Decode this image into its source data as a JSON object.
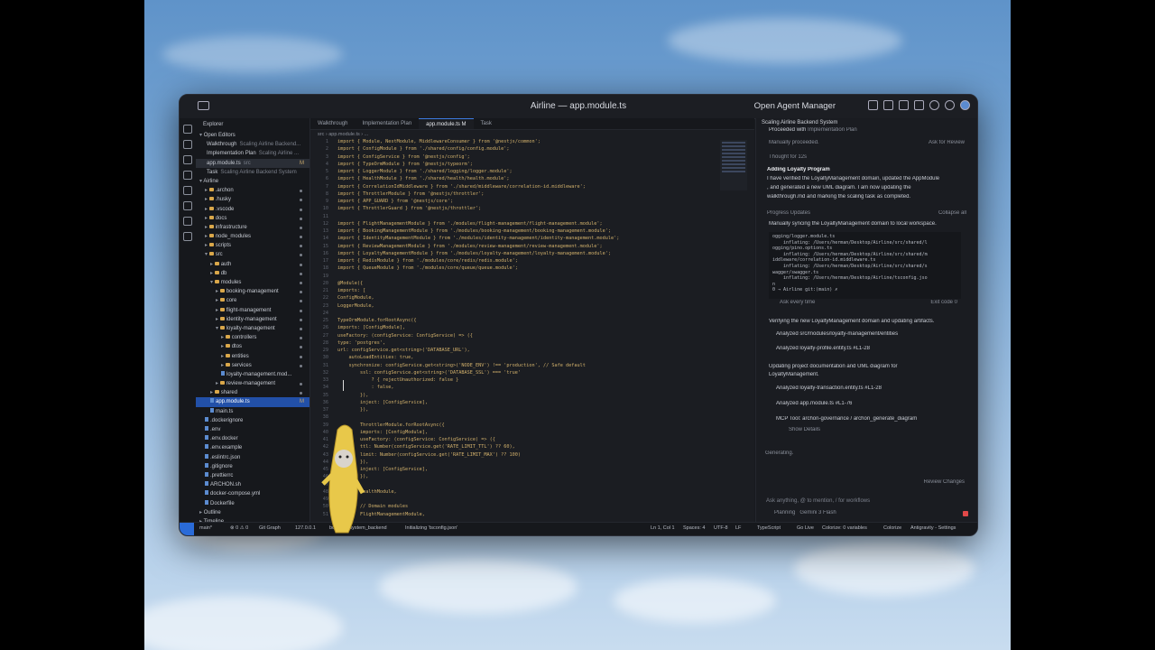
{
  "window": {
    "title": "Airline — app.module.ts",
    "right_title": "Open Agent Manager"
  },
  "explorer": {
    "header": "Explorer",
    "open_editors_label": "Open Editors",
    "open_editors": [
      {
        "name": "Walkthrough",
        "detail": "Scaling Airline Backend..."
      },
      {
        "name": "Implementation Plan",
        "detail": "Scaling Airline ..."
      },
      {
        "name": "app.module.ts",
        "detail": "src",
        "mark": "M"
      },
      {
        "name": "Task",
        "detail": "Scaling Airline Backend System"
      }
    ],
    "project_label": "Airline",
    "tree": [
      {
        "name": ".archon",
        "kind": "folder"
      },
      {
        "name": ".husky",
        "kind": "folder"
      },
      {
        "name": ".vscode",
        "kind": "folder"
      },
      {
        "name": "docs",
        "kind": "folder"
      },
      {
        "name": "infrastructure",
        "kind": "folder"
      },
      {
        "name": "node_modules",
        "kind": "folder"
      },
      {
        "name": "scripts",
        "kind": "folder"
      },
      {
        "name": "src",
        "kind": "folder-open"
      },
      {
        "name": "auth",
        "kind": "folder"
      },
      {
        "name": "db",
        "kind": "folder"
      },
      {
        "name": "modules",
        "kind": "folder-open"
      },
      {
        "name": "booking-management",
        "kind": "folder"
      },
      {
        "name": "core",
        "kind": "folder"
      },
      {
        "name": "flight-management",
        "kind": "folder"
      },
      {
        "name": "identity-management",
        "kind": "folder"
      },
      {
        "name": "loyalty-management",
        "kind": "folder-open"
      },
      {
        "name": "controllers",
        "kind": "folder"
      },
      {
        "name": "dtos",
        "kind": "folder"
      },
      {
        "name": "entities",
        "kind": "folder"
      },
      {
        "name": "services",
        "kind": "folder"
      },
      {
        "name": "loyalty-management.mod...",
        "kind": "file"
      },
      {
        "name": "review-management",
        "kind": "folder"
      },
      {
        "name": "shared",
        "kind": "folder"
      },
      {
        "name": "app.module.ts",
        "kind": "file",
        "selected": true,
        "mark": "M"
      },
      {
        "name": "main.ts",
        "kind": "file"
      },
      {
        "name": ".dockerignore",
        "kind": "file"
      },
      {
        "name": ".env",
        "kind": "file"
      },
      {
        "name": ".env.docker",
        "kind": "file"
      },
      {
        "name": ".env.example",
        "kind": "file"
      },
      {
        "name": ".eslintrc.json",
        "kind": "file"
      },
      {
        "name": ".gitignore",
        "kind": "file"
      },
      {
        "name": ".prettierrc",
        "kind": "file"
      },
      {
        "name": "ARCHON.sh",
        "kind": "file"
      },
      {
        "name": "docker-compose.yml",
        "kind": "file"
      },
      {
        "name": "Dockerfile",
        "kind": "file"
      }
    ],
    "outline_label": "Outline",
    "timeline_label": "Timeline"
  },
  "editor": {
    "tabs": [
      "Walkthrough",
      "Implementation Plan",
      "app.module.ts M",
      "Task"
    ],
    "breadcrumb": "src  ›  app.module.ts  ›  ...",
    "lines": [
      "import { Module, NestModule, MiddlewareConsumer } from '@nestjs/common';",
      "import { ConfigModule } from './shared/config/config.module';",
      "import { ConfigService } from '@nestjs/config';",
      "import { TypeOrmModule } from '@nestjs/typeorm';",
      "import { LoggerModule } from './shared/logging/logger.module';",
      "import { HealthModule } from './shared/health/health.module';",
      "import { CorrelationIdMiddleware } from './shared/middleware/correlation-id.middleware';",
      "import { ThrottlerModule } from '@nestjs/throttler';",
      "import { APP_GUARD } from '@nestjs/core';",
      "import { ThrottlerGuard } from '@nestjs/throttler';",
      "",
      "import { FlightManagementModule } from './modules/flight-management/flight-management.module';",
      "import { BookingManagementModule } from './modules/booking-management/booking-management.module';",
      "import { IdentityManagementModule } from './modules/identity-management/identity-management.module';",
      "import { ReviewManagementModule } from './modules/review-management/review-management.module';",
      "import { LoyaltyManagementModule } from './modules/loyalty-management/loyalty-management.module';",
      "import { RedisModule } from './modules/core/redis/redis.module';",
      "import { QueueModule } from './modules/core/queue/queue.module';",
      "",
      "@Module({",
      "imports: [",
      "ConfigModule,",
      "LoggerModule,",
      "",
      "TypeOrmModule.forRootAsync({",
      "imports: [ConfigModule],",
      "useFactory: (configService: ConfigService) => ({",
      "type: 'postgres',",
      "url: configService.get<string>('DATABASE_URL'),",
      "    autoLoadEntities: true,",
      "    synchronize: configService.get<string>('NODE_ENV') !== 'production', // Safe default",
      "        ssl: configService.get<string>('DATABASE_SSL') === 'true'",
      "            ? { rejectUnauthorized: false }",
      "            : false,",
      "        }),",
      "        inject: [ConfigService],",
      "        }),",
      "",
      "        ThrottlerModule.forRootAsync({",
      "        imports: [ConfigModule],",
      "        useFactory: (configService: ConfigService) => ({",
      "        ttl: Number(configService.get('RATE_LIMIT_TTL') ?? 60),",
      "        limit: Number(configService.get('RATE_LIMIT_MAX') ?? 100)",
      "        }),",
      "        inject: [ConfigService],",
      "        }),",
      "",
      "        HealthModule,",
      "",
      "        // Domain modules",
      "        FlightManagementModule,"
    ]
  },
  "agent": {
    "header": "Scaling Airline Backend System",
    "proceeded_with": "Proceeded with",
    "proceeded_target": "Implementation Plan",
    "manually_proceeded": "Manually proceeded.",
    "ask_for_review": "Ask for Review",
    "thought": "Thought for 12s",
    "section_title": "Adding Loyalty Program",
    "para1": "I have verified the LoyaltyManagement domain, updated the  AppModule",
    "para2": ", and generated a new UML diagram. I am now updating the",
    "para3": "walkthrough.md  and marking the scaling task as completed.",
    "progress_label": "Progress Updates",
    "collapse_all": "Collapse all",
    "step1": "Manually syncing the LoyaltyManagement domain to local workspace.",
    "term": [
      "ogging/logger.module.ts",
      "    inflating: /Users/herman/Desktop/Airline/src/shared/l",
      "ogging/pino.options.ts",
      "    inflating: /Users/herman/Desktop/Airline/src/shared/m",
      "iddleware/correlation-id.middleware.ts",
      "    inflating: /Users/herman/Desktop/Airline/src/shared/s",
      "wagger/swagger.ts",
      "    inflating: /Users/herman/Desktop/Airline/tsconfig.jso",
      "n",
      "0 → Airline git:(main) ✗"
    ],
    "ask_every_time": "Ask every time",
    "exit_code": "Exit code 0",
    "step2": "Verifying the new LoyaltyManagement domain and updating artifacts.",
    "analyzed_dir": "Analyzed src/modules/loyalty-management/entities",
    "analyzed_file1": "Analyzed  loyalty-profile.entity.ts #L1-28",
    "step3a": "Updating project documentation and UML diagram for",
    "step3b": "LoyaltyManagement.",
    "analyzed_file2": "Analyzed  loyalty-transaction.entity.ts #L1-28",
    "analyzed_file3": "Analyzed  app.module.ts #L1-76",
    "mcp_tool": "MCP Tool: archon-governance / archon_generate_diagram",
    "show_details": "Show Details",
    "generating": "Generating.",
    "review_changes": "Review Changes",
    "input_placeholder": "Ask anything, @ to mention, / for workflows",
    "mode": "Planning",
    "model": "Gemini 3 Flash"
  },
  "status": {
    "branch": "main*",
    "problems": "⊗ 0 ⚠ 0",
    "git_graph": "Git Graph",
    "host": "127.0.0.1",
    "booking": "booking_system_backend",
    "init": "Initializing 'tsconfig.json'",
    "position": "Ln 1, Col 1",
    "spaces": "Spaces: 4",
    "encoding": "UTF-8",
    "eol": "LF",
    "language": "TypeScript",
    "go_live": "Go Live",
    "colorize_vars": "Colorize: 0 variables",
    "colorize": "Colorize",
    "settings": "Antigravity - Settings"
  }
}
